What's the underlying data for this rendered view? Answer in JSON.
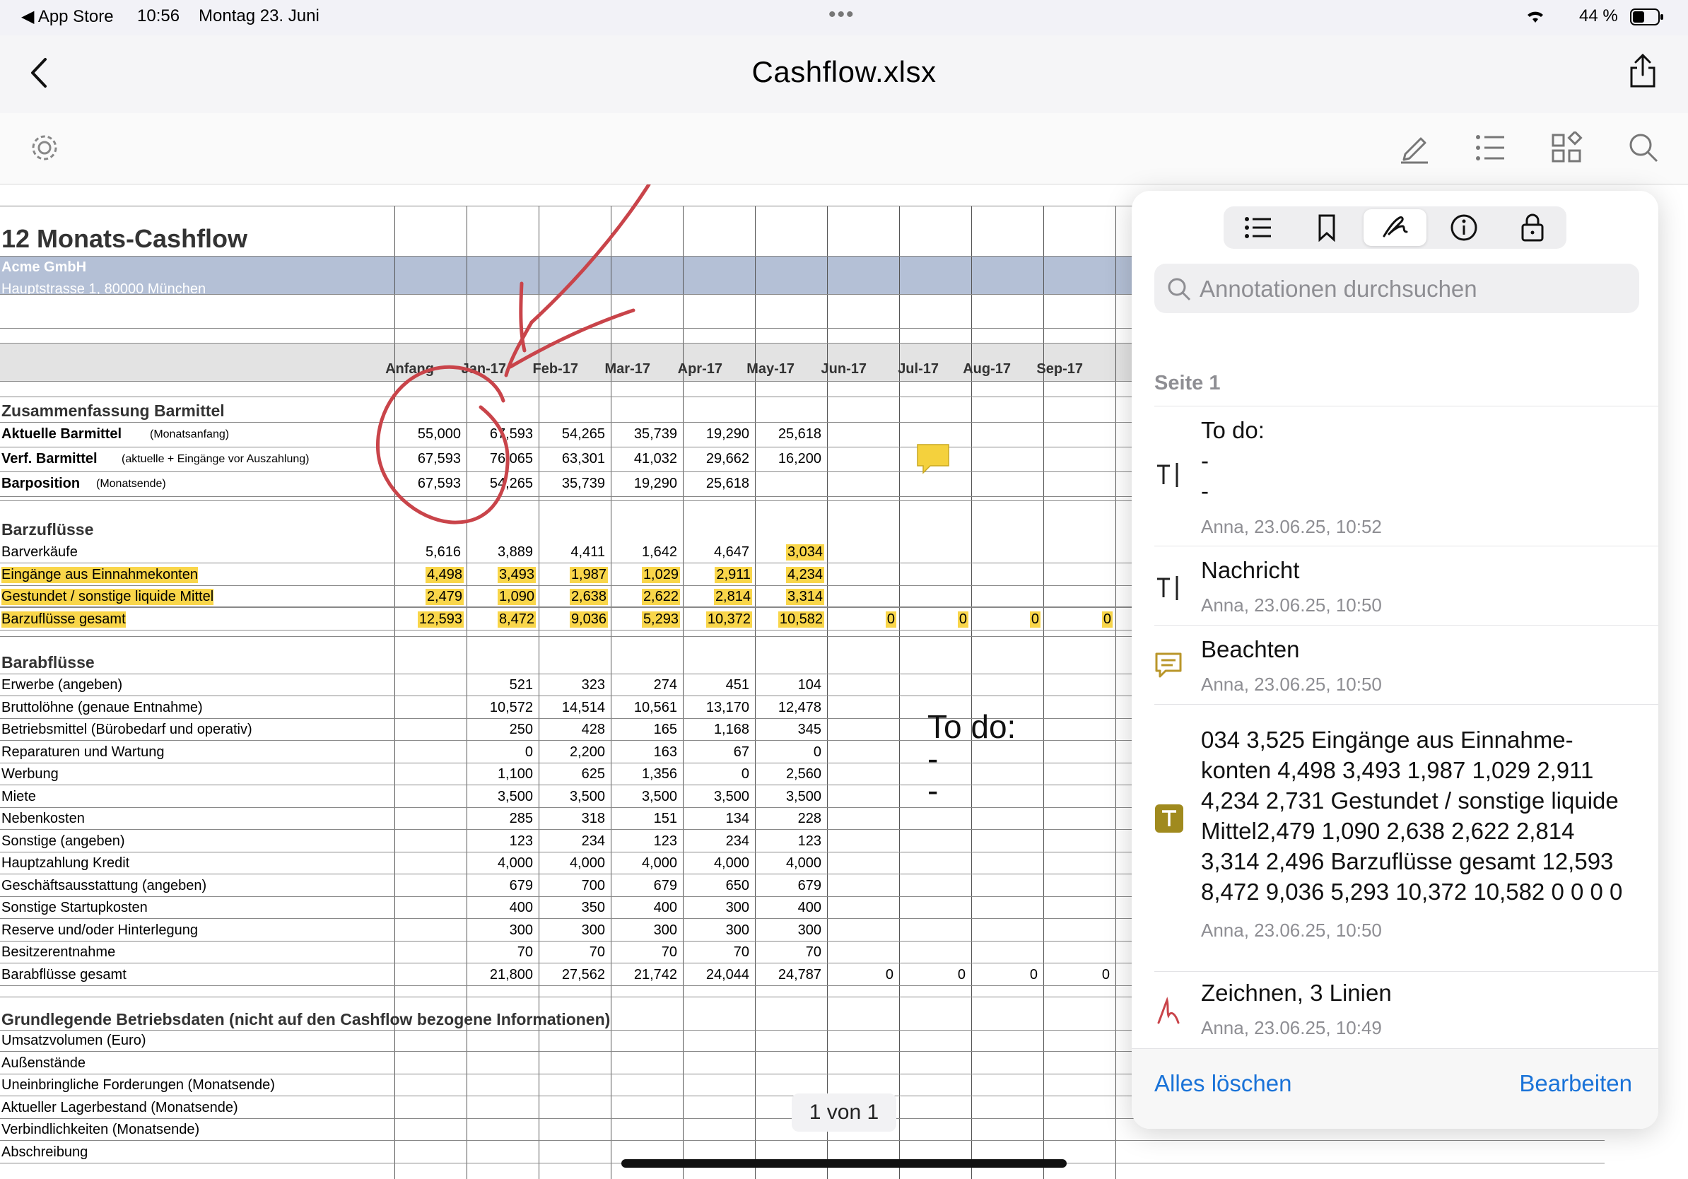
{
  "status": {
    "back_app": "App Store",
    "time": "10:56",
    "date": "Montag 23. Juni",
    "battery": "44 %"
  },
  "nav": {
    "title": "Cashflow.xlsx"
  },
  "sheet": {
    "title": "12 Monats-Cashflow",
    "company": "Acme GmbH",
    "address": "Hauptstrasse 1, 80000 München",
    "months": [
      "Anfang",
      "Jan-17",
      "Feb-17",
      "Mar-17",
      "Apr-17",
      "May-17",
      "Jun-17",
      "Jul-17",
      "Aug-17",
      "Sep-17"
    ],
    "sections": {
      "summary": "Zusammenfassung Barmittel",
      "inflows": "Barzuflüsse",
      "outflows": "Barabflüsse",
      "base": "Grundlegende Betriebsdaten (nicht auf den Cashflow bezogene Informationen)"
    },
    "summary_rows": [
      {
        "label": "Aktuelle Barmittel",
        "note": "(Monatsanfang)",
        "values": [
          "55,000",
          "67,593",
          "54,265",
          "35,739",
          "19,290",
          "25,618"
        ]
      },
      {
        "label": "Verf. Barmittel",
        "note": "(aktuelle + Eingänge vor Auszahlung)",
        "values": [
          "67,593",
          "76,065",
          "63,301",
          "41,032",
          "29,662",
          "16,200"
        ]
      },
      {
        "label": "Barposition",
        "note": "(Monatsende)",
        "values": [
          "67,593",
          "54,265",
          "35,739",
          "19,290",
          "25,618",
          ""
        ]
      }
    ],
    "inflow_rows": [
      {
        "label": "Barverkäufe",
        "values": [
          "5,616",
          "3,889",
          "4,411",
          "1,642",
          "4,647",
          "3,034"
        ],
        "hl": false
      },
      {
        "label": "Eingänge aus Einnahmekonten",
        "values": [
          "4,498",
          "3,493",
          "1,987",
          "1,029",
          "2,911",
          "4,234"
        ],
        "hl": true
      },
      {
        "label": "Gestundet / sonstige liquide Mittel",
        "values": [
          "2,479",
          "1,090",
          "2,638",
          "2,622",
          "2,814",
          "3,314"
        ],
        "hl": true
      },
      {
        "label": "Barzuflüsse gesamt",
        "values": [
          "12,593",
          "8,472",
          "9,036",
          "5,293",
          "10,372",
          "10,582",
          "0",
          "0",
          "0",
          "0"
        ],
        "hl": true
      }
    ],
    "outflow_rows": [
      {
        "label": "Erwerbe (angeben)",
        "values": [
          "",
          "521",
          "323",
          "274",
          "451",
          "104"
        ]
      },
      {
        "label": "Bruttolöhne (genaue Entnahme)",
        "values": [
          "",
          "10,572",
          "14,514",
          "10,561",
          "13,170",
          "12,478"
        ]
      },
      {
        "label": "Betriebsmittel (Bürobedarf und operativ)",
        "values": [
          "",
          "250",
          "428",
          "165",
          "1,168",
          "345"
        ]
      },
      {
        "label": "Reparaturen und Wartung",
        "values": [
          "",
          "0",
          "2,200",
          "163",
          "67",
          "0"
        ]
      },
      {
        "label": "Werbung",
        "values": [
          "",
          "1,100",
          "625",
          "1,356",
          "0",
          "2,560"
        ]
      },
      {
        "label": "Miete",
        "values": [
          "",
          "3,500",
          "3,500",
          "3,500",
          "3,500",
          "3,500"
        ]
      },
      {
        "label": "Nebenkosten",
        "values": [
          "",
          "285",
          "318",
          "151",
          "134",
          "228"
        ]
      },
      {
        "label": "Sonstige (angeben)",
        "values": [
          "",
          "123",
          "234",
          "123",
          "234",
          "123"
        ]
      },
      {
        "label": "Hauptzahlung Kredit",
        "values": [
          "",
          "4,000",
          "4,000",
          "4,000",
          "4,000",
          "4,000"
        ]
      },
      {
        "label": "Geschäftsausstattung (angeben)",
        "values": [
          "",
          "679",
          "700",
          "679",
          "650",
          "679"
        ]
      },
      {
        "label": "Sonstige Startupkosten",
        "values": [
          "",
          "400",
          "350",
          "400",
          "300",
          "400"
        ]
      },
      {
        "label": "Reserve und/oder Hinterlegung",
        "values": [
          "",
          "300",
          "300",
          "300",
          "300",
          "300"
        ]
      },
      {
        "label": "Besitzerentnahme",
        "values": [
          "",
          "70",
          "70",
          "70",
          "70",
          "70"
        ]
      },
      {
        "label": "Barabflüsse gesamt",
        "values": [
          "",
          "21,800",
          "27,562",
          "21,742",
          "24,044",
          "24,787",
          "0",
          "0",
          "0",
          "0"
        ]
      }
    ],
    "base_rows": [
      "Umsatzvolumen (Euro)",
      "Außenstände",
      "Uneinbringliche Forderungen (Monatsende)",
      "Aktueller Lagerbestand (Monatsende)",
      "Verbindlichkeiten (Monatsende)",
      "Abschreibung"
    ],
    "note_text": "To do:\n-\n-"
  },
  "panel": {
    "search_placeholder": "Annotationen durchsuchen",
    "section": "Seite 1",
    "annotations": [
      {
        "text": "To do:\n-\n-",
        "meta": "Anna, 23.06.25, 10:52",
        "icon": "text-box-icon"
      },
      {
        "text": "Nachricht",
        "meta": "Anna, 23.06.25, 10:50",
        "icon": "text-box-icon"
      },
      {
        "text": "Beachten",
        "meta": "Anna, 23.06.25, 10:50",
        "icon": "comment-icon"
      },
      {
        "text": "034 3,525 Eingänge aus Einnahme-\nkonten 4,498 3,493 1,987 1,029 2,911\n4,234 2,731 Gestundet / sonstige liquide\nMittel2,479 1,090 2,638 2,622 2,814\n3,314 2,496 Barzuflüsse gesamt 12,593\n8,472 9,036 5,293 10,372 10,582 0 0 0 0",
        "meta": "Anna, 23.06.25, 10:50",
        "icon": "highlight-text-icon"
      },
      {
        "text": "Zeichnen, 3 Linien",
        "meta": "Anna, 23.06.25, 10:49",
        "icon": "ink-icon"
      }
    ],
    "clear_all": "Alles löschen",
    "edit": "Bearbeiten"
  },
  "page_indicator": "1 von 1",
  "colors": {
    "accent": "#1a73d8",
    "highlight": "#f9d64a",
    "header_band": "#b4c0d6",
    "ink": "#c9444a"
  }
}
